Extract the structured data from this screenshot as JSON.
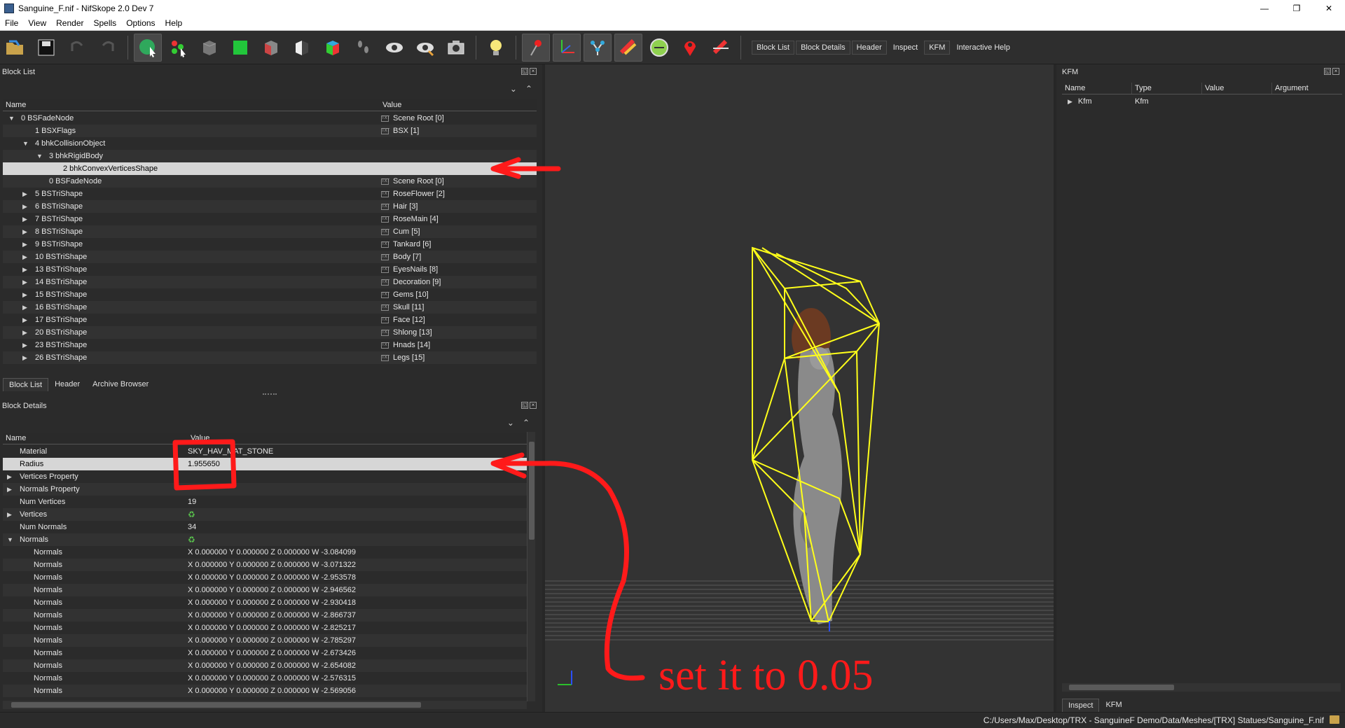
{
  "window": {
    "title": "Sanguine_F.nif - NifSkope 2.0 Dev 7",
    "minimize": "—",
    "maximize": "❐",
    "close": "✕"
  },
  "menu": [
    "File",
    "View",
    "Render",
    "Spells",
    "Options",
    "Help"
  ],
  "toolbar": {
    "text_buttons": [
      "Block List",
      "Block Details",
      "Header",
      "Inspect",
      "KFM",
      "Interactive Help"
    ]
  },
  "block_list": {
    "title": "Block List",
    "columns": [
      "Name",
      "Value"
    ],
    "rows": [
      {
        "name": "0 BSFadeNode",
        "value": "Scene Root [0]",
        "indent": 0,
        "arrow": "down"
      },
      {
        "name": "1 BSXFlags",
        "value": "BSX [1]",
        "indent": 1,
        "arrow": ""
      },
      {
        "name": "4 bhkCollisionObject",
        "value": "",
        "indent": 1,
        "arrow": "down"
      },
      {
        "name": "3 bhkRigidBody",
        "value": "",
        "indent": 2,
        "arrow": "down"
      },
      {
        "name": "2 bhkConvexVerticesShape",
        "value": "",
        "indent": 3,
        "arrow": ""
      },
      {
        "name": "0 BSFadeNode",
        "value": "Scene Root [0]",
        "indent": 2,
        "arrow": ""
      },
      {
        "name": "5 BSTriShape",
        "value": "RoseFlower [2]",
        "indent": 1,
        "arrow": "right"
      },
      {
        "name": "6 BSTriShape",
        "value": "Hair [3]",
        "indent": 1,
        "arrow": "right"
      },
      {
        "name": "7 BSTriShape",
        "value": "RoseMain [4]",
        "indent": 1,
        "arrow": "right"
      },
      {
        "name": "8 BSTriShape",
        "value": "Cum [5]",
        "indent": 1,
        "arrow": "right"
      },
      {
        "name": "9 BSTriShape",
        "value": "Tankard [6]",
        "indent": 1,
        "arrow": "right"
      },
      {
        "name": "10 BSTriShape",
        "value": "Body [7]",
        "indent": 1,
        "arrow": "right"
      },
      {
        "name": "13 BSTriShape",
        "value": "EyesNails [8]",
        "indent": 1,
        "arrow": "right"
      },
      {
        "name": "14 BSTriShape",
        "value": "Decoration [9]",
        "indent": 1,
        "arrow": "right"
      },
      {
        "name": "15 BSTriShape",
        "value": "Gems [10]",
        "indent": 1,
        "arrow": "right"
      },
      {
        "name": "16 BSTriShape",
        "value": "Skull [11]",
        "indent": 1,
        "arrow": "right"
      },
      {
        "name": "17 BSTriShape",
        "value": "Face [12]",
        "indent": 1,
        "arrow": "right"
      },
      {
        "name": "20 BSTriShape",
        "value": "Shlong [13]",
        "indent": 1,
        "arrow": "right"
      },
      {
        "name": "23 BSTriShape",
        "value": "Hnads [14]",
        "indent": 1,
        "arrow": "right"
      },
      {
        "name": "26 BSTriShape",
        "value": "Legs [15]",
        "indent": 1,
        "arrow": "right"
      }
    ],
    "selected_row": 4,
    "tabs": [
      "Block List",
      "Header",
      "Archive Browser"
    ]
  },
  "block_details": {
    "title": "Block Details",
    "columns": [
      "Name",
      "Value"
    ],
    "rows": [
      {
        "name": "Material",
        "value": "SKY_HAV_MAT_STONE",
        "indent": 0,
        "arrow": ""
      },
      {
        "name": "Radius",
        "value": "1.955650",
        "indent": 0,
        "arrow": ""
      },
      {
        "name": "Vertices Property",
        "value": "",
        "indent": 0,
        "arrow": "right"
      },
      {
        "name": "Normals Property",
        "value": "",
        "indent": 0,
        "arrow": "right"
      },
      {
        "name": "Num Vertices",
        "value": "19",
        "indent": 0,
        "arrow": ""
      },
      {
        "name": "Vertices",
        "value": "♻",
        "indent": 0,
        "arrow": "right"
      },
      {
        "name": "Num Normals",
        "value": "34",
        "indent": 0,
        "arrow": ""
      },
      {
        "name": "Normals",
        "value": "♻",
        "indent": 0,
        "arrow": "down"
      },
      {
        "name": "Normals",
        "value": "X 0.000000 Y 0.000000 Z 0.000000 W -3.084099",
        "indent": 1,
        "arrow": ""
      },
      {
        "name": "Normals",
        "value": "X 0.000000 Y 0.000000 Z 0.000000 W -3.071322",
        "indent": 1,
        "arrow": ""
      },
      {
        "name": "Normals",
        "value": "X 0.000000 Y 0.000000 Z 0.000000 W -2.953578",
        "indent": 1,
        "arrow": ""
      },
      {
        "name": "Normals",
        "value": "X 0.000000 Y 0.000000 Z 0.000000 W -2.946562",
        "indent": 1,
        "arrow": ""
      },
      {
        "name": "Normals",
        "value": "X 0.000000 Y 0.000000 Z 0.000000 W -2.930418",
        "indent": 1,
        "arrow": ""
      },
      {
        "name": "Normals",
        "value": "X 0.000000 Y 0.000000 Z 0.000000 W -2.866737",
        "indent": 1,
        "arrow": ""
      },
      {
        "name": "Normals",
        "value": "X 0.000000 Y 0.000000 Z 0.000000 W -2.825217",
        "indent": 1,
        "arrow": ""
      },
      {
        "name": "Normals",
        "value": "X 0.000000 Y 0.000000 Z 0.000000 W -2.785297",
        "indent": 1,
        "arrow": ""
      },
      {
        "name": "Normals",
        "value": "X 0.000000 Y 0.000000 Z 0.000000 W -2.673426",
        "indent": 1,
        "arrow": ""
      },
      {
        "name": "Normals",
        "value": "X 0.000000 Y 0.000000 Z 0.000000 W -2.654082",
        "indent": 1,
        "arrow": ""
      },
      {
        "name": "Normals",
        "value": "X 0.000000 Y 0.000000 Z 0.000000 W -2.576315",
        "indent": 1,
        "arrow": ""
      },
      {
        "name": "Normals",
        "value": "X 0.000000 Y 0.000000 Z 0.000000 W -2.569056",
        "indent": 1,
        "arrow": ""
      }
    ],
    "selected_row": 1
  },
  "kfm": {
    "title": "KFM",
    "columns": [
      "Name",
      "Type",
      "Value",
      "Argument"
    ],
    "row": {
      "name": "Kfm",
      "type": "Kfm"
    },
    "tabs": [
      "Inspect",
      "KFM"
    ]
  },
  "status": {
    "path": "C:/Users/Max/Desktop/TRX - SanguineF Demo/Data/Meshes/[TRX] Statues/Sanguine_F.nif"
  },
  "annotation": {
    "text": "set it to 0.05",
    "color": "#ff1a1a"
  },
  "colors": {
    "accent_yellow": "#ffff1a",
    "selection": "#d6d6d6",
    "background": "#2b2b2b"
  }
}
